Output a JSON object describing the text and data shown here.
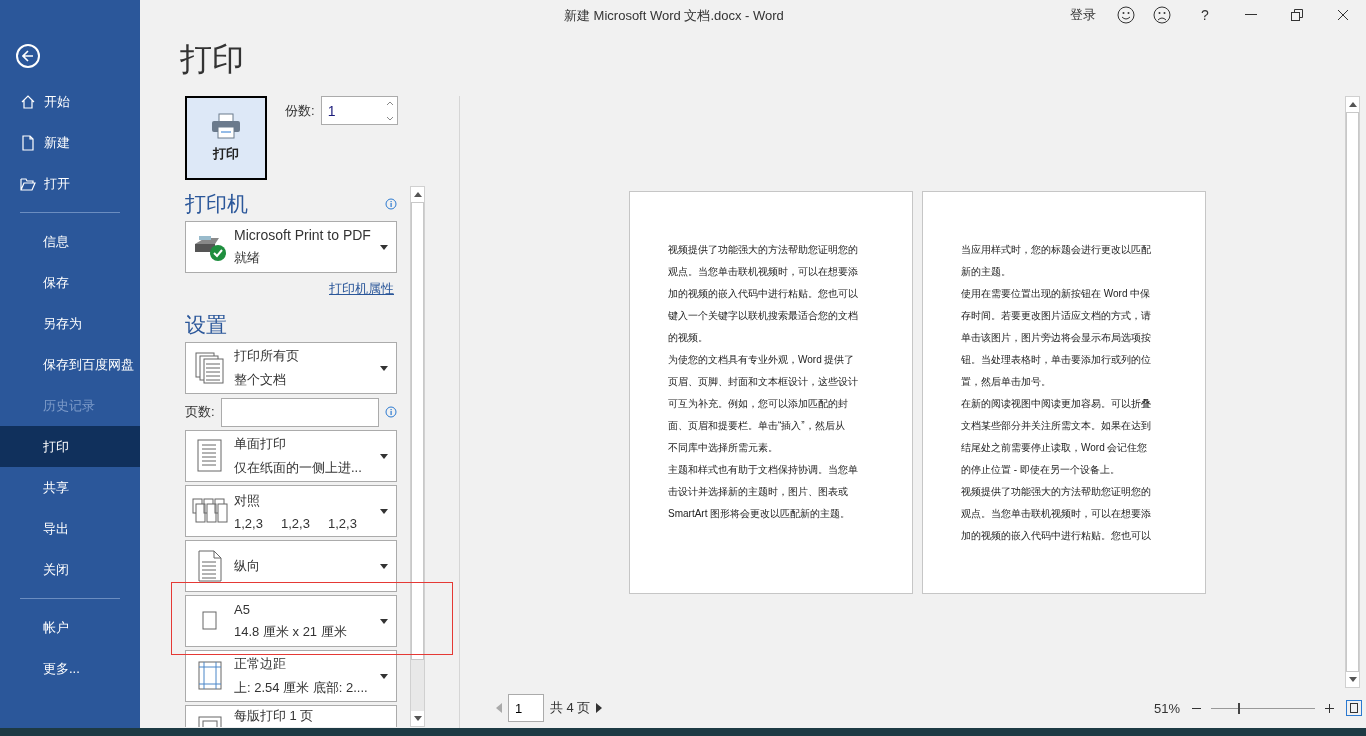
{
  "window": {
    "title": "新建 Microsoft Word 文档.docx  -  Word",
    "signin": "登录",
    "help": "?"
  },
  "sidebar": {
    "items": [
      {
        "label": "开始",
        "kind": "home",
        "selected": false,
        "disabled": false
      },
      {
        "label": "新建",
        "kind": "new",
        "selected": false,
        "disabled": false
      },
      {
        "label": "打开",
        "kind": "open",
        "selected": false,
        "disabled": false
      },
      {
        "kind": "divider"
      },
      {
        "label": "信息",
        "kind": "text",
        "selected": false,
        "disabled": false
      },
      {
        "label": "保存",
        "kind": "text",
        "selected": false,
        "disabled": false
      },
      {
        "label": "另存为",
        "kind": "text",
        "selected": false,
        "disabled": false
      },
      {
        "label": "保存到百度网盘",
        "kind": "text",
        "selected": false,
        "disabled": false
      },
      {
        "label": "历史记录",
        "kind": "text",
        "selected": false,
        "disabled": true
      },
      {
        "label": "打印",
        "kind": "text",
        "selected": true,
        "disabled": false
      },
      {
        "label": "共享",
        "kind": "text",
        "selected": false,
        "disabled": false
      },
      {
        "label": "导出",
        "kind": "text",
        "selected": false,
        "disabled": false
      },
      {
        "label": "关闭",
        "kind": "text",
        "selected": false,
        "disabled": false
      },
      {
        "kind": "divider"
      },
      {
        "label": "帐户",
        "kind": "text",
        "selected": false,
        "disabled": false
      },
      {
        "label": "更多...",
        "kind": "text",
        "selected": false,
        "disabled": false
      }
    ]
  },
  "heading": "打印",
  "print_button": "打印",
  "copies": {
    "label": "份数:",
    "value": "1"
  },
  "printer": {
    "heading": "打印机",
    "name": "Microsoft Print to PDF",
    "status": "就绪",
    "properties_link": "打印机属性"
  },
  "settings": {
    "heading": "设置",
    "pages_label": "页数:",
    "options": [
      {
        "kind": "pages",
        "title": "打印所有页",
        "detail": "整个文档"
      },
      {
        "kind": "sided",
        "title": "单面打印",
        "detail": "仅在纸面的一侧上进..."
      },
      {
        "kind": "collate",
        "title": "对照",
        "detail": "1,2,3     1,2,3     1,2,3"
      },
      {
        "kind": "orientation",
        "title": "纵向"
      },
      {
        "kind": "paper",
        "title": "A5",
        "detail": "14.8 厘米 x 21 厘米"
      },
      {
        "kind": "margins",
        "title": "正常边距",
        "detail": "上: 2.54 厘米 底部: 2...."
      },
      {
        "kind": "persheet",
        "title": "每版打印 1 页"
      }
    ]
  },
  "preview": {
    "pages": [
      {
        "lines": [
          "视频提供了功能强大的方法帮助您证明您的",
          "观点。当您单击联机视频时，可以在想要添",
          "加的视频的嵌入代码中进行粘贴。您也可以",
          "键入一个关键字以联机搜索最适合您的文档",
          "的视频。",
          "为使您的文档具有专业外观，Word 提供了",
          "页眉、页脚、封面和文本框设计，这些设计",
          "可互为补充。例如，您可以添加匹配的封",
          "面、页眉和提要栏。单击“插入”，然后从",
          "不同库中选择所需元素。",
          "主题和样式也有助于文档保持协调。当您单",
          "击设计并选择新的主题时，图片、图表或",
          "SmartArt 图形将会更改以匹配新的主题。"
        ]
      },
      {
        "lines": [
          "当应用样式时，您的标题会进行更改以匹配",
          "新的主题。",
          "使用在需要位置出现的新按钮在 Word 中保",
          "存时间。若要更改图片适应文档的方式，请",
          "单击该图片，图片旁边将会显示布局选项按",
          "钮。当处理表格时，单击要添加行或列的位",
          "置，然后单击加号。",
          "在新的阅读视图中阅读更加容易。可以折叠",
          "文档某些部分并关注所需文本。如果在达到",
          "结尾处之前需要停止读取，Word 会记住您",
          "的停止位置 - 即使在另一个设备上。",
          "视频提供了功能强大的方法帮助您证明您的",
          "观点。当您单击联机视频时，可以在想要添",
          "加的视频的嵌入代码中进行粘贴。您也可以"
        ]
      }
    ]
  },
  "pager": {
    "page": "1",
    "total": "共 4 页"
  },
  "zoom": {
    "percent": "51%",
    "level": 0.26
  }
}
